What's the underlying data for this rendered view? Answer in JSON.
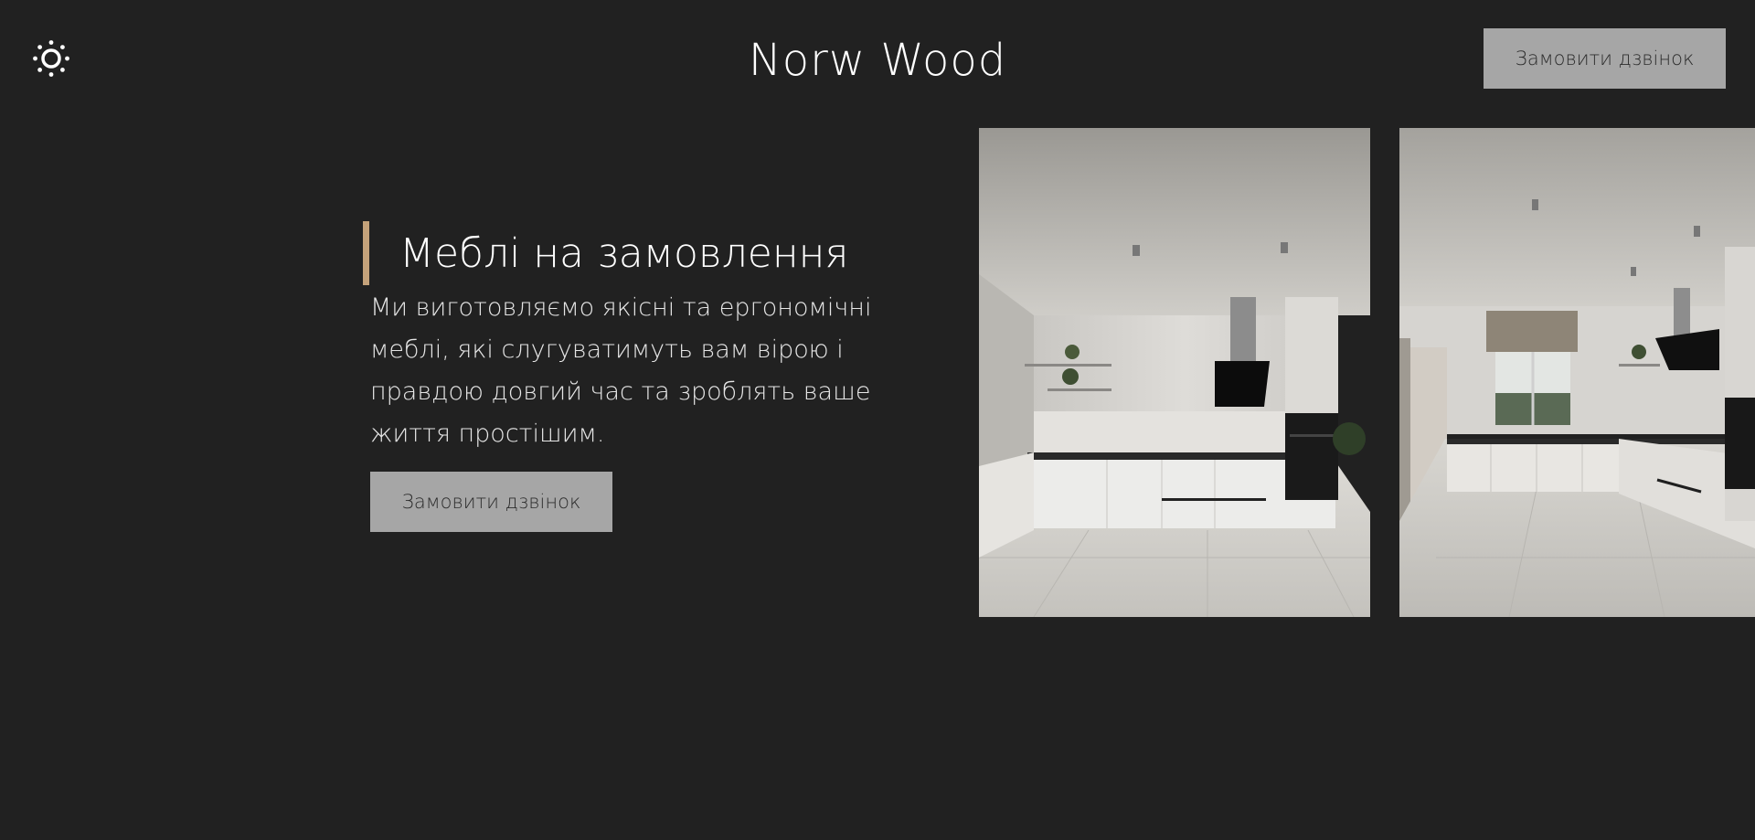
{
  "header": {
    "brand": "Norw Wood",
    "cta_label": "Замовити дзвінок",
    "theme_toggle_icon": "sun-icon"
  },
  "hero": {
    "title": "Меблі на замовлення",
    "description": "Ми виготовляємо якісні та ергономічні меблі, які слугуватимуть вам вірою і правдою довгий час та зроблять ваше життя простішим.",
    "cta_label": "Замовити дзвінок"
  },
  "gallery": {
    "images": [
      {
        "subject": "kitchen-photo"
      },
      {
        "subject": "kitchen-photo"
      }
    ]
  },
  "colors": {
    "background": "#212121",
    "accent": "#c4a27a",
    "button": "#a6a6a6",
    "button_text": "#2d2d2d"
  }
}
